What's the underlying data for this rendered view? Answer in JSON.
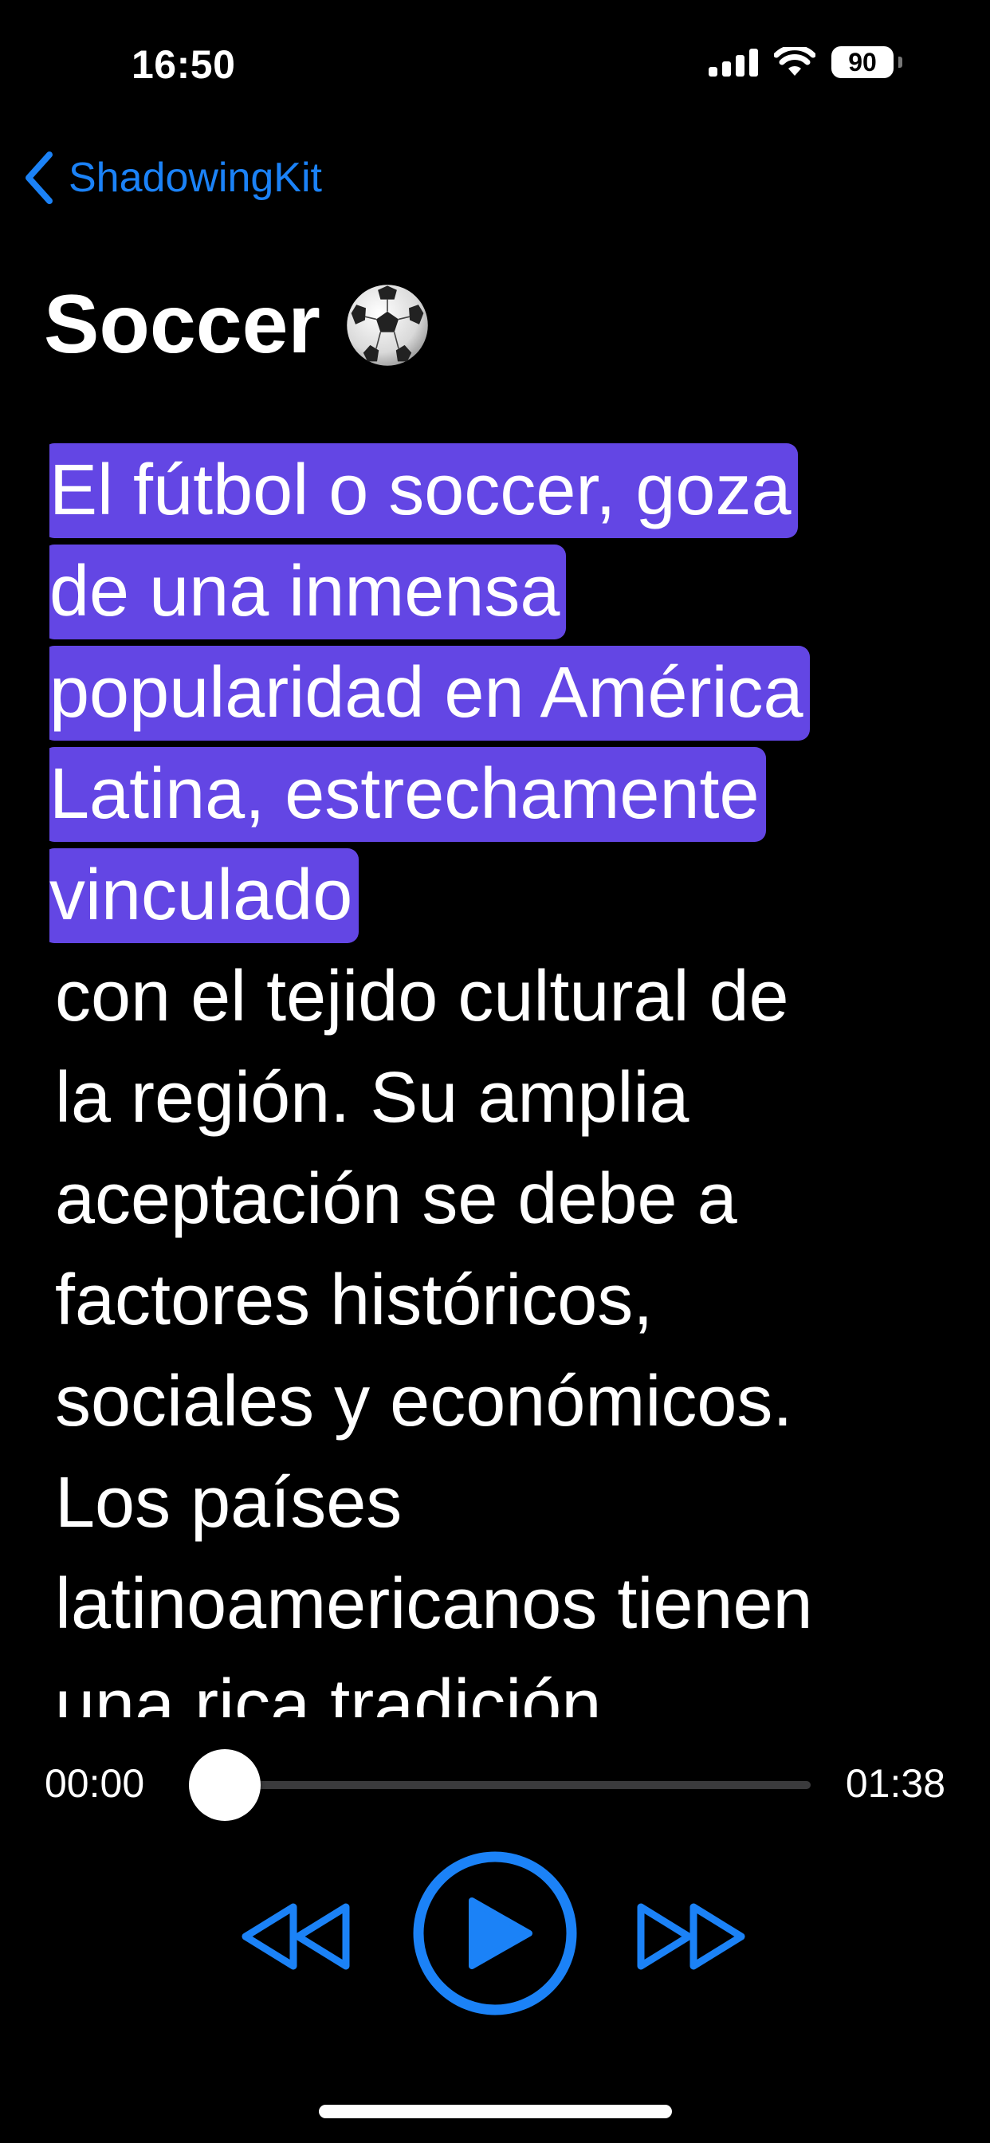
{
  "status_bar": {
    "time": "16:50",
    "battery": "90",
    "battery_level_percent": 90,
    "icons": [
      "cellular-signal-icon",
      "wifi-icon",
      "battery-icon"
    ]
  },
  "nav": {
    "back_label": "ShadowingKit",
    "back_icon": "chevron-left-icon"
  },
  "page": {
    "title": "Soccer",
    "title_icon": "soccer-ball-icon"
  },
  "transcript": {
    "highlighted_lines": [
      "El fútbol o soccer, goza",
      "de una inmensa",
      "popularidad en América",
      "Latina, estrechamente",
      "vinculado"
    ],
    "lines": [
      "con el tejido cultural de",
      "la región. Su amplia",
      "aceptación se debe a",
      "factores históricos,",
      "sociales y económicos.",
      "Los países",
      "latinoamericanos tienen",
      "una rica tradición"
    ]
  },
  "player": {
    "elapsed": "00:00",
    "total": "01:38",
    "progress_fraction": 0.0,
    "controls": [
      "rewind-icon",
      "play-icon",
      "fast-forward-icon"
    ]
  },
  "colors": {
    "accent": "#1b82f7",
    "highlight": "#6346e4",
    "background": "#000000",
    "text": "#ffffff",
    "track": "#3a3a3c"
  }
}
